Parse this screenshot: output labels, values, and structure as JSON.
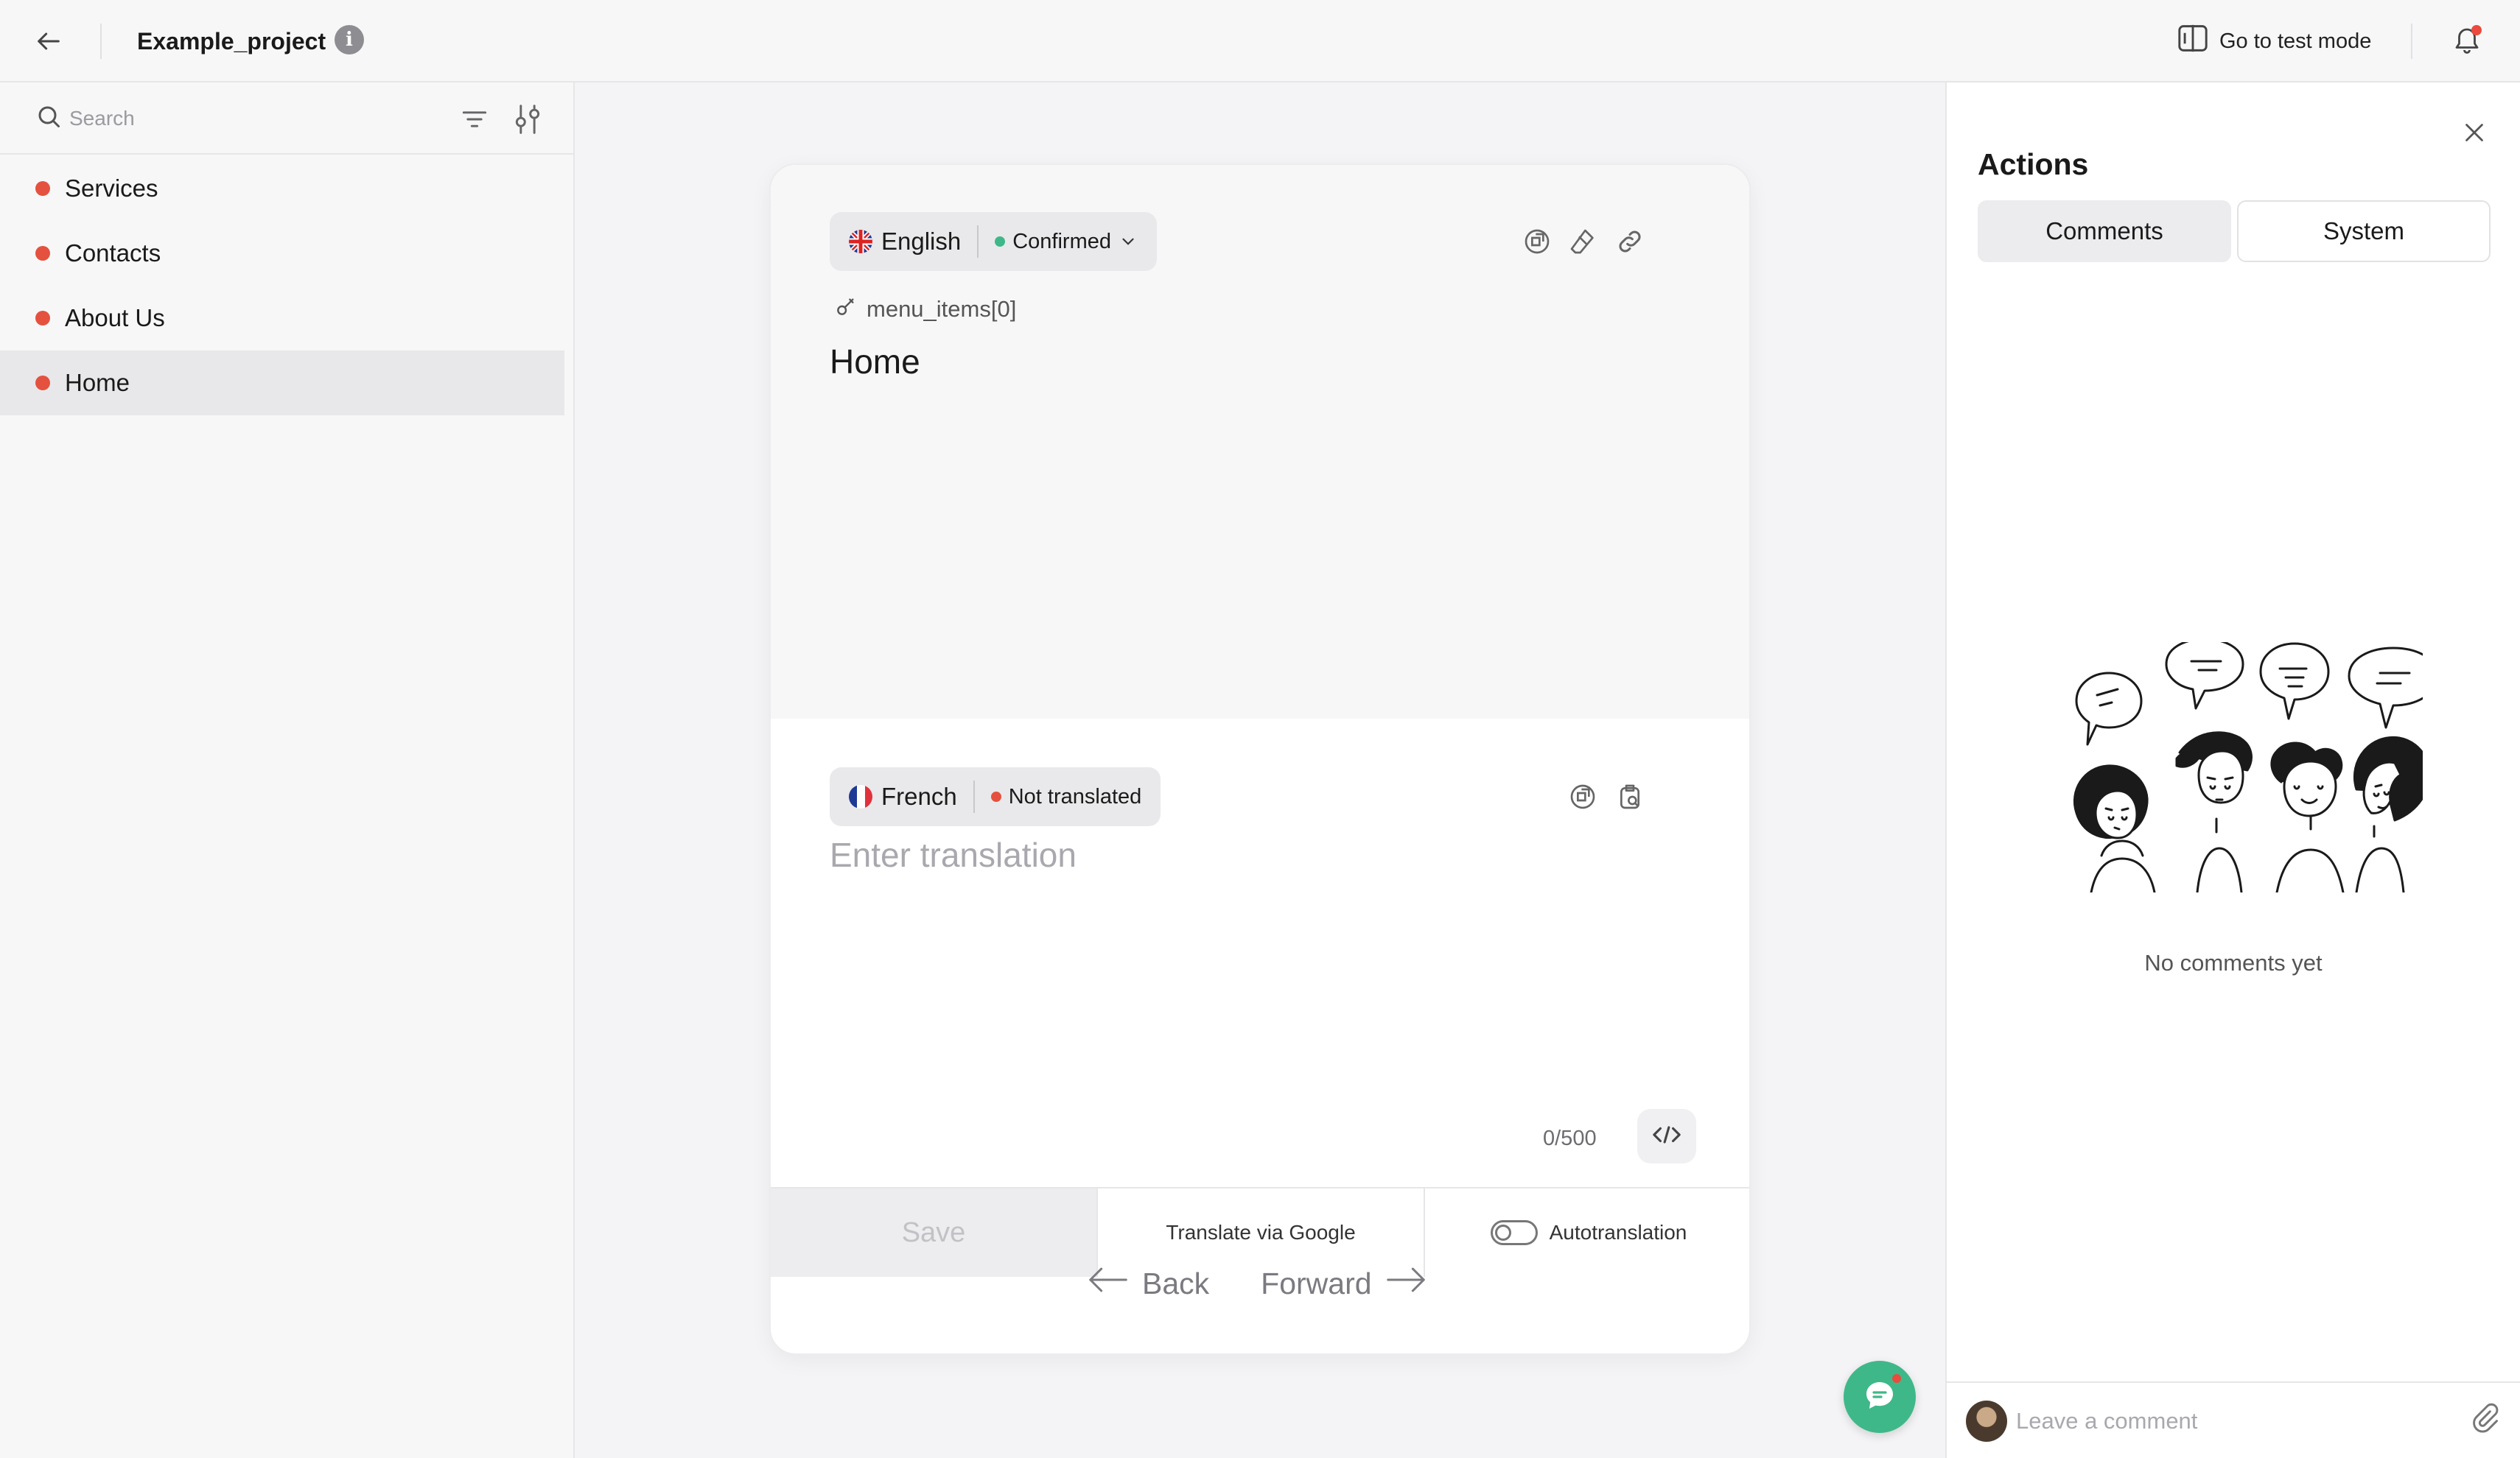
{
  "header": {
    "project_title": "Example_project",
    "info_label": "i",
    "test_mode_label": "Go to test mode"
  },
  "sidebar": {
    "search_placeholder": "Search",
    "items": [
      {
        "label": "Services"
      },
      {
        "label": "Contacts"
      },
      {
        "label": "About Us"
      },
      {
        "label": "Home",
        "active": true
      }
    ]
  },
  "editor": {
    "source": {
      "language": "English",
      "status": "Confirmed",
      "status_color": "#3fb889",
      "key": "menu_items[0]",
      "text": "Home"
    },
    "target": {
      "language": "French",
      "status": "Not translated",
      "status_color": "#e5513f",
      "placeholder": "Enter translation",
      "counter": "0/500"
    },
    "footer": {
      "save_label": "Save",
      "google_label": "Translate via Google",
      "autotranslation_label": "Autotranslation"
    },
    "nav": {
      "back_label": "Back",
      "forward_label": "Forward"
    }
  },
  "panel": {
    "title": "Actions",
    "tabs": [
      {
        "label": "Comments",
        "active": true
      },
      {
        "label": "System"
      }
    ],
    "empty_text": "No comments yet",
    "comment_placeholder": "Leave a comment"
  },
  "colors": {
    "accent_green": "#3fb889",
    "alert_red": "#e5513f"
  }
}
